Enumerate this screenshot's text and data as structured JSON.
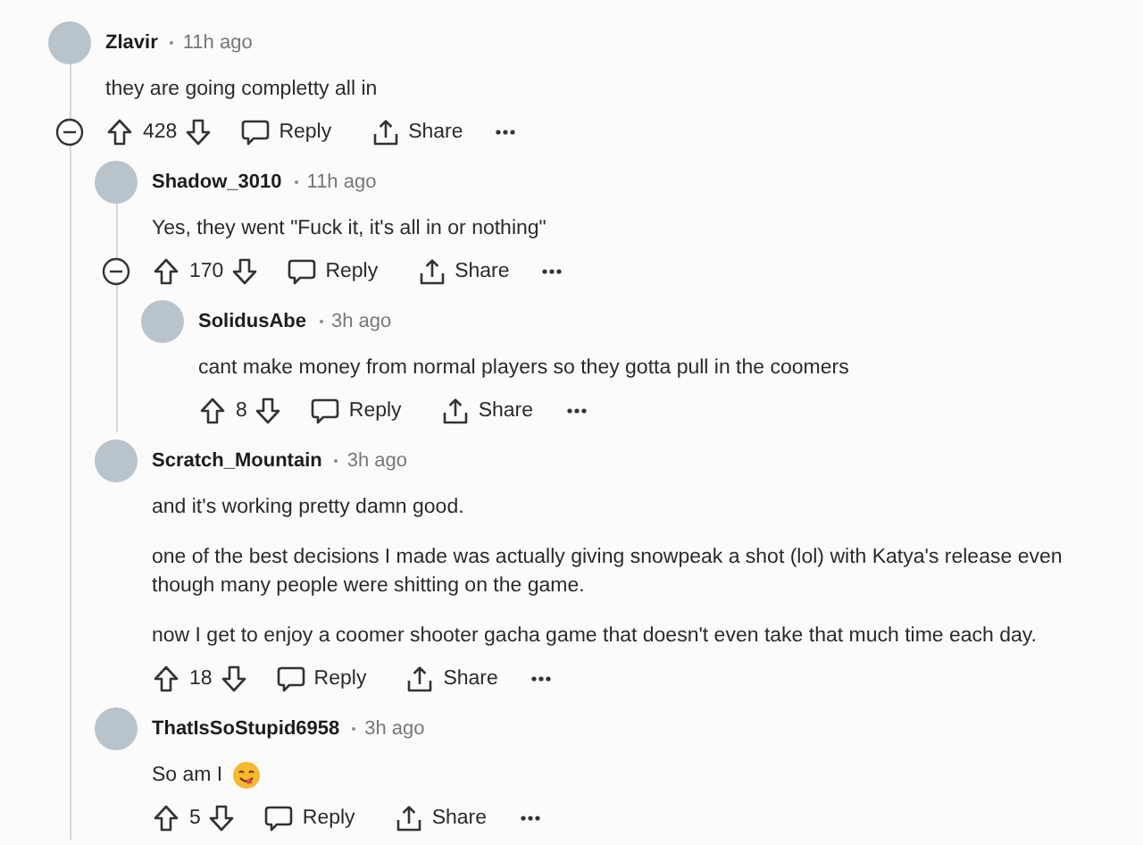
{
  "comments": [
    {
      "author": "Zlavir",
      "time": "11h ago",
      "paragraphs": [
        "they are going completty all in"
      ],
      "votes": "428",
      "reply_label": "Reply",
      "share_label": "Share",
      "children": [
        {
          "author": "Shadow_3010",
          "time": "11h ago",
          "paragraphs": [
            "Yes, they went \"Fuck it, it's all in or nothing\""
          ],
          "votes": "170",
          "reply_label": "Reply",
          "share_label": "Share",
          "children": [
            {
              "author": "SolidusAbe",
              "time": "3h ago",
              "paragraphs": [
                "cant make money from normal players so they gotta pull in the coomers"
              ],
              "votes": "8",
              "reply_label": "Reply",
              "share_label": "Share"
            }
          ]
        },
        {
          "author": "Scratch_Mountain",
          "time": "3h ago",
          "paragraphs": [
            "and it's working pretty damn good.",
            "one of the best decisions I made was actually giving snowpeak a shot (lol) with Katya's release even though many people were shitting on the game.",
            "now I get to enjoy a coomer shooter gacha game that doesn't even take that much time each day."
          ],
          "votes": "18",
          "reply_label": "Reply",
          "share_label": "Share"
        },
        {
          "author": "ThatIsSoStupid6958",
          "time": "3h ago",
          "paragraphs": [
            "So am I"
          ],
          "emoji_after_text": true,
          "votes": "5",
          "reply_label": "Reply",
          "share_label": "Share"
        }
      ]
    }
  ]
}
